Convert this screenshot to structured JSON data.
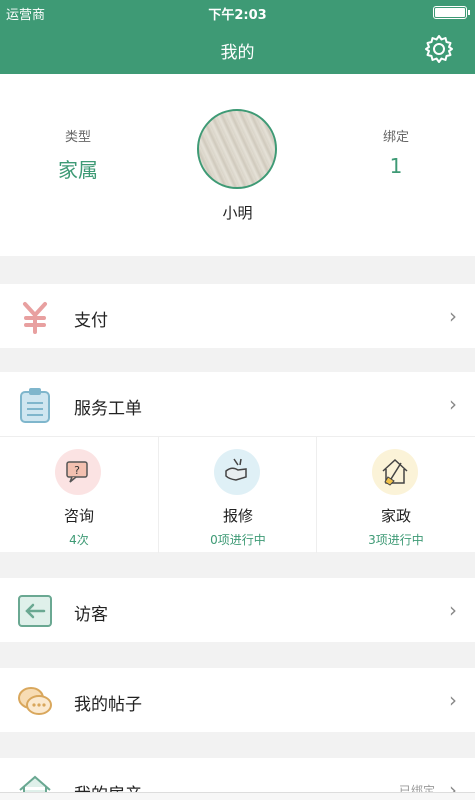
{
  "status_bar": {
    "carrier": "运营商",
    "time": "下午2:03"
  },
  "header": {
    "title": "我的"
  },
  "profile": {
    "type_label": "类型",
    "type_value": "家属",
    "bind_label": "绑定",
    "bind_value": "1",
    "username": "小明"
  },
  "menu": {
    "pay": {
      "label": "支付"
    },
    "service_orders": {
      "label": "服务工单"
    },
    "visitors": {
      "label": "访客"
    },
    "my_posts": {
      "label": "我的帖子"
    },
    "my_house": {
      "label": "我的房产",
      "tail": "已绑定"
    }
  },
  "services": [
    {
      "name": "咨询",
      "stat": "4次",
      "color": "#fbe3e3"
    },
    {
      "name": "报修",
      "stat": "0项进行中",
      "color": "#dff0f6"
    },
    {
      "name": "家政",
      "stat": "3项进行中",
      "color": "#fbf3d8"
    }
  ],
  "colors": {
    "accent": "#3e9a75",
    "background": "#f2f2f2"
  }
}
